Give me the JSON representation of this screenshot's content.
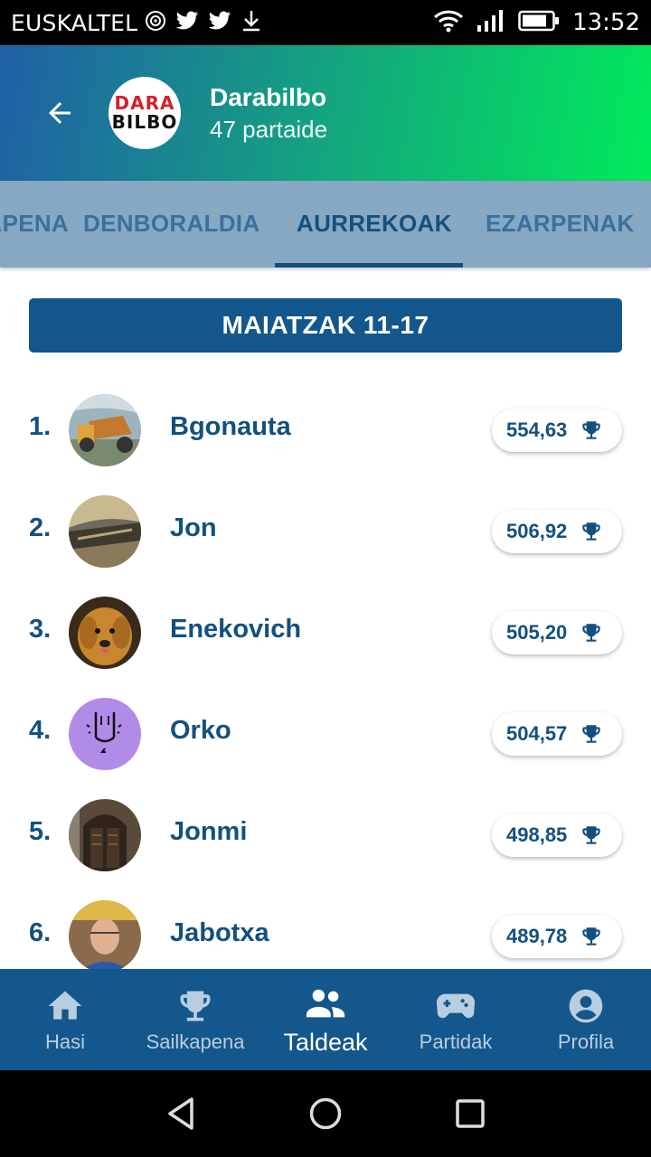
{
  "status_bar": {
    "carrier": "EUSKALTEL",
    "time": "13:52",
    "left_icons": [
      "cast-icon",
      "twitter-icon",
      "twitter-icon",
      "download-icon"
    ],
    "right_icons": [
      "wifi-icon",
      "signal-icon",
      "battery-icon"
    ]
  },
  "header": {
    "group_name": "Darabilbo",
    "members": "47 partaide",
    "logo_line1": "DARA",
    "logo_line2": "BILBO",
    "back_icon": "arrow-back-icon",
    "gradient_colors": [
      "#1f5fa6",
      "#14a47f",
      "#00ea5a"
    ]
  },
  "tabs": [
    {
      "label": "SAILKAPENA",
      "active": false
    },
    {
      "label": "DENBORALDIA",
      "active": false
    },
    {
      "label": "AURREKOAK",
      "active": true
    },
    {
      "label": "EZARPENAK",
      "active": false
    }
  ],
  "week": {
    "label": "MAIATZAK 11-17"
  },
  "ranking": [
    {
      "pos": "1.",
      "name": "Bgonauta",
      "score": "554,63"
    },
    {
      "pos": "2.",
      "name": "Jon",
      "score": "506,92"
    },
    {
      "pos": "3.",
      "name": "Enekovich",
      "score": "505,20"
    },
    {
      "pos": "4.",
      "name": "Orko",
      "score": "504,57"
    },
    {
      "pos": "5.",
      "name": "Jonmi",
      "score": "498,85"
    },
    {
      "pos": "6.",
      "name": "Jabotxa",
      "score": "489,78"
    }
  ],
  "bottom_nav": [
    {
      "label": "Hasi",
      "icon": "home-icon",
      "active": false
    },
    {
      "label": "Sailkapena",
      "icon": "trophy-icon",
      "active": false
    },
    {
      "label": "Taldeak",
      "icon": "group-icon",
      "active": true
    },
    {
      "label": "Partidak",
      "icon": "gamepad-icon",
      "active": false
    },
    {
      "label": "Profila",
      "icon": "account-icon",
      "active": false
    }
  ],
  "colors": {
    "primary": "#13507f",
    "nav_bg": "#13578c",
    "tabs_bg": "#86a8c2"
  }
}
